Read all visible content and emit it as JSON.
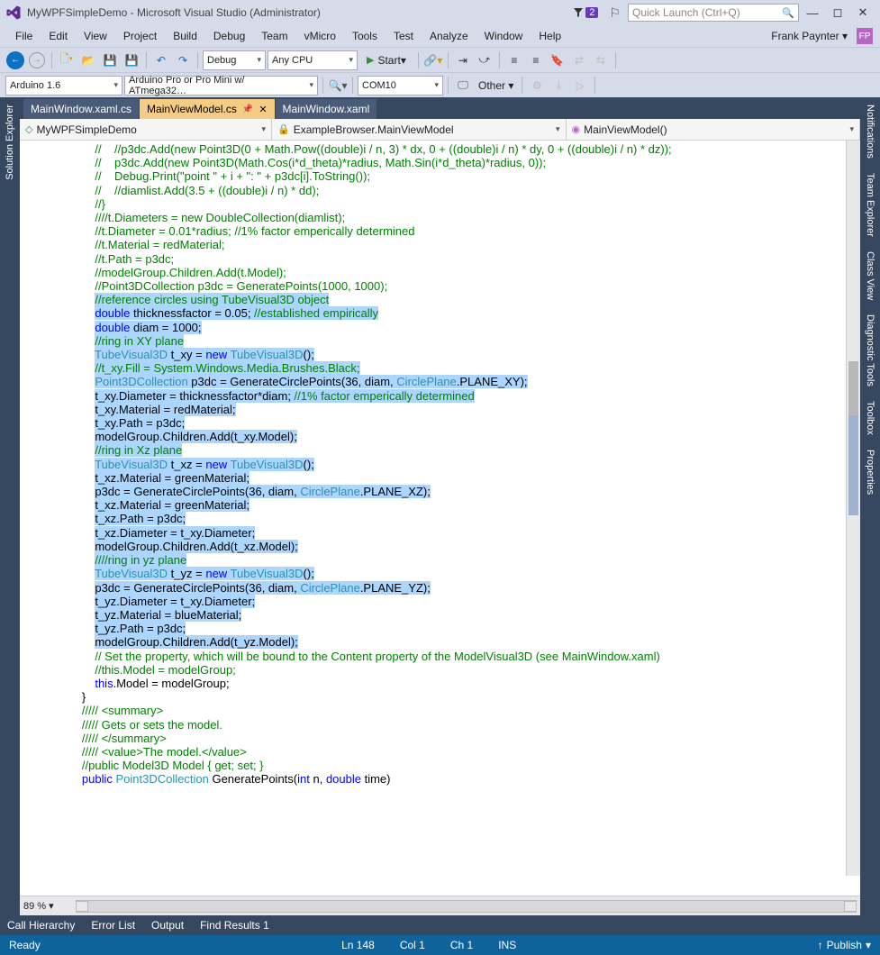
{
  "title": "MyWPFSimpleDemo - Microsoft Visual Studio (Administrator)",
  "notifications_count": "2",
  "quick_launch_placeholder": "Quick Launch (Ctrl+Q)",
  "user_name": "Frank Paynter",
  "user_initials": "FP",
  "menu": [
    "File",
    "Edit",
    "View",
    "Project",
    "Build",
    "Debug",
    "Team",
    "vMicro",
    "Tools",
    "Test",
    "Analyze",
    "Window",
    "Help"
  ],
  "toolbar1": {
    "config": "Debug",
    "platform": "Any CPU",
    "start": "Start"
  },
  "toolbar2": {
    "arduino": "Arduino 1.6",
    "board": "Arduino Pro or Pro Mini w/ ATmega32…",
    "port": "COM10",
    "other": "Other"
  },
  "left_rail": [
    "Solution Explorer"
  ],
  "right_rail": [
    "Notifications",
    "Team Explorer",
    "Class View",
    "Diagnostic Tools",
    "Toolbox",
    "Properties"
  ],
  "tabs": [
    {
      "label": "MainWindow.xaml.cs",
      "active": false
    },
    {
      "label": "MainViewModel.cs",
      "active": true
    },
    {
      "label": "MainWindow.xaml",
      "active": false
    }
  ],
  "nav": {
    "project": "MyWPFSimpleDemo",
    "class": "ExampleBrowser.MainViewModel",
    "member": "MainViewModel()"
  },
  "zoom": "89 %",
  "bottom_tabs": [
    "Call Hierarchy",
    "Error List",
    "Output",
    "Find Results 1"
  ],
  "status": {
    "ready": "Ready",
    "ln": "Ln 148",
    "col": "Col 1",
    "ch": "Ch 1",
    "ins": "INS",
    "publish": "Publish"
  },
  "code_lines": [
    {
      "i": "            ",
      "t": [
        [
          "cm",
          "//    //p3dc.Add(new Point3D(0 + Math.Pow((double)i / n, 3) * dx, 0 + ((double)i / n) * dy, 0 + ((double)i / n) * dz));"
        ]
      ]
    },
    {
      "i": "            ",
      "t": [
        [
          "cm",
          "//    p3dc.Add(new Point3D(Math.Cos(i*d_theta)*radius, Math.Sin(i*d_theta)*radius, 0));"
        ]
      ]
    },
    {
      "i": "            ",
      "t": [
        [
          "cm",
          "//    Debug.Print(\"point \" + i + \": \" + p3dc[i].ToString());"
        ]
      ]
    },
    {
      "i": "            ",
      "t": [
        [
          "cm",
          "//    //diamlist.Add(3.5 + ((double)i / n) * dd);"
        ]
      ]
    },
    {
      "i": "            ",
      "t": [
        [
          "cm",
          "//}"
        ]
      ]
    },
    {
      "i": "            ",
      "t": [
        [
          "cm",
          "////t.Diameters = new DoubleCollection(diamlist);"
        ]
      ]
    },
    {
      "i": "            ",
      "t": [
        [
          "cm",
          "//t.Diameter = 0.01*radius; //1% factor emperically determined"
        ]
      ]
    },
    {
      "i": "            ",
      "t": [
        [
          "cm",
          "//t.Material = redMaterial;"
        ]
      ]
    },
    {
      "i": "            ",
      "t": [
        [
          "cm",
          "//t.Path = p3dc;"
        ]
      ]
    },
    {
      "i": "            ",
      "t": [
        [
          "cm",
          "//modelGroup.Children.Add(t.Model);"
        ]
      ]
    },
    {
      "i": "",
      "t": [
        [
          "",
          ""
        ]
      ]
    },
    {
      "i": "            ",
      "t": [
        [
          "cm",
          "//Point3DCollection p3dc = GeneratePoints(1000, 1000);"
        ]
      ]
    },
    {
      "i": "",
      "t": [
        [
          "",
          ""
        ]
      ]
    },
    {
      "i": "            ",
      "sel": true,
      "t": [
        [
          "cm",
          "//reference circles using TubeVisual3D object"
        ]
      ]
    },
    {
      "i": "            ",
      "sel": true,
      "t": [
        [
          "kw",
          "double"
        ],
        [
          "",
          " thicknessfactor = 0.05; "
        ],
        [
          "cm",
          "//established empirically"
        ]
      ]
    },
    {
      "i": "            ",
      "sel": true,
      "t": [
        [
          "kw",
          "double"
        ],
        [
          "",
          " diam = 1000;"
        ]
      ]
    },
    {
      "i": "",
      "t": [
        [
          "",
          ""
        ]
      ]
    },
    {
      "i": "            ",
      "sel": true,
      "t": [
        [
          "cm",
          "//ring in XY plane"
        ]
      ]
    },
    {
      "i": "            ",
      "sel": true,
      "t": [
        [
          "ty",
          "TubeVisual3D"
        ],
        [
          "",
          " t_xy = "
        ],
        [
          "kw",
          "new"
        ],
        [
          "",
          " "
        ],
        [
          "ty",
          "TubeVisual3D"
        ],
        [
          "",
          "();"
        ]
      ]
    },
    {
      "i": "            ",
      "sel": true,
      "t": [
        [
          "cm",
          "//t_xy.Fill = System.Windows.Media.Brushes.Black;"
        ]
      ]
    },
    {
      "i": "            ",
      "sel": true,
      "t": [
        [
          "ty",
          "Point3DCollection"
        ],
        [
          "",
          " p3dc = GenerateCirclePoints(36, diam, "
        ],
        [
          "ty",
          "CirclePlane"
        ],
        [
          "",
          ".PLANE_XY);"
        ]
      ]
    },
    {
      "i": "            ",
      "sel": true,
      "t": [
        [
          "",
          "t_xy.Diameter = thicknessfactor*diam; "
        ],
        [
          "cm",
          "//1% factor emperically determined"
        ]
      ]
    },
    {
      "i": "            ",
      "sel": true,
      "t": [
        [
          "",
          "t_xy.Material = redMaterial;"
        ]
      ]
    },
    {
      "i": "            ",
      "sel": true,
      "t": [
        [
          "",
          "t_xy.Path = p3dc;"
        ]
      ]
    },
    {
      "i": "            ",
      "sel": true,
      "t": [
        [
          "",
          "modelGroup.Children.Add(t_xy.Model);"
        ]
      ]
    },
    {
      "i": "",
      "t": [
        [
          "",
          ""
        ]
      ]
    },
    {
      "i": "            ",
      "sel": true,
      "t": [
        [
          "cm",
          "//ring in Xz plane"
        ]
      ]
    },
    {
      "i": "            ",
      "sel": true,
      "t": [
        [
          "ty",
          "TubeVisual3D"
        ],
        [
          "",
          " t_xz = "
        ],
        [
          "kw",
          "new"
        ],
        [
          "",
          " "
        ],
        [
          "ty",
          "TubeVisual3D"
        ],
        [
          "",
          "();"
        ]
      ]
    },
    {
      "i": "            ",
      "sel": true,
      "t": [
        [
          "",
          "t_xz.Material = greenMaterial;"
        ]
      ]
    },
    {
      "i": "            ",
      "sel": true,
      "t": [
        [
          "",
          "p3dc = GenerateCirclePoints(36, diam, "
        ],
        [
          "ty",
          "CirclePlane"
        ],
        [
          "",
          ".PLANE_XZ);"
        ]
      ]
    },
    {
      "i": "            ",
      "sel": true,
      "t": [
        [
          "",
          "t_xz.Material = greenMaterial;"
        ]
      ]
    },
    {
      "i": "            ",
      "sel": true,
      "t": [
        [
          "",
          "t_xz.Path = p3dc;"
        ]
      ]
    },
    {
      "i": "            ",
      "sel": true,
      "t": [
        [
          "",
          "t_xz.Diameter = t_xy.Diameter;"
        ]
      ]
    },
    {
      "i": "            ",
      "sel": true,
      "t": [
        [
          "",
          "modelGroup.Children.Add(t_xz.Model);"
        ]
      ]
    },
    {
      "i": "",
      "t": [
        [
          "",
          ""
        ]
      ]
    },
    {
      "i": "            ",
      "sel": true,
      "t": [
        [
          "cm",
          "////ring in yz plane"
        ]
      ]
    },
    {
      "i": "            ",
      "sel": true,
      "t": [
        [
          "ty",
          "TubeVisual3D"
        ],
        [
          "",
          " t_yz = "
        ],
        [
          "kw",
          "new"
        ],
        [
          "",
          " "
        ],
        [
          "ty",
          "TubeVisual3D"
        ],
        [
          "",
          "();"
        ]
      ]
    },
    {
      "i": "            ",
      "sel": true,
      "t": [
        [
          "",
          "p3dc = GenerateCirclePoints(36, diam, "
        ],
        [
          "ty",
          "CirclePlane"
        ],
        [
          "",
          ".PLANE_YZ);"
        ]
      ]
    },
    {
      "i": "            ",
      "sel": true,
      "t": [
        [
          "",
          "t_yz.Diameter = t_xy.Diameter;"
        ]
      ]
    },
    {
      "i": "            ",
      "sel": true,
      "t": [
        [
          "",
          "t_yz.Material = blueMaterial;"
        ]
      ]
    },
    {
      "i": "            ",
      "sel": true,
      "t": [
        [
          "",
          "t_yz.Path = p3dc;"
        ]
      ]
    },
    {
      "i": "            ",
      "sel": true,
      "t": [
        [
          "",
          "modelGroup.Children.Add(t_yz.Model);"
        ]
      ]
    },
    {
      "i": "",
      "t": [
        [
          "",
          ""
        ]
      ]
    },
    {
      "i": "            ",
      "t": [
        [
          "cm",
          "// Set the property, which will be bound to the Content property of the ModelVisual3D (see MainWindow.xaml)"
        ]
      ]
    },
    {
      "i": "            ",
      "t": [
        [
          "cm",
          "//this.Model = modelGroup;"
        ]
      ]
    },
    {
      "i": "            ",
      "t": [
        [
          "kw",
          "this"
        ],
        [
          "",
          ".Model = modelGroup;"
        ]
      ]
    },
    {
      "i": "        ",
      "t": [
        [
          "",
          "}"
        ]
      ]
    },
    {
      "i": "",
      "t": [
        [
          "",
          ""
        ]
      ]
    },
    {
      "i": "        ",
      "t": [
        [
          "cm",
          "///// <summary>"
        ]
      ]
    },
    {
      "i": "        ",
      "t": [
        [
          "cm",
          "///// Gets or sets the model."
        ]
      ]
    },
    {
      "i": "        ",
      "t": [
        [
          "cm",
          "///// </summary>"
        ]
      ]
    },
    {
      "i": "        ",
      "t": [
        [
          "cm",
          "///// <value>The model.</value>"
        ]
      ]
    },
    {
      "i": "        ",
      "t": [
        [
          "cm",
          "//public Model3D Model { get; set; }"
        ]
      ]
    },
    {
      "i": "",
      "t": [
        [
          "",
          ""
        ]
      ]
    },
    {
      "i": "        ",
      "t": [
        [
          "kw",
          "public"
        ],
        [
          "",
          " "
        ],
        [
          "ty",
          "Point3DCollection"
        ],
        [
          "",
          " GeneratePoints("
        ],
        [
          "kw",
          "int"
        ],
        [
          "",
          " n, "
        ],
        [
          "kw",
          "double"
        ],
        [
          "",
          " time)"
        ]
      ]
    }
  ]
}
